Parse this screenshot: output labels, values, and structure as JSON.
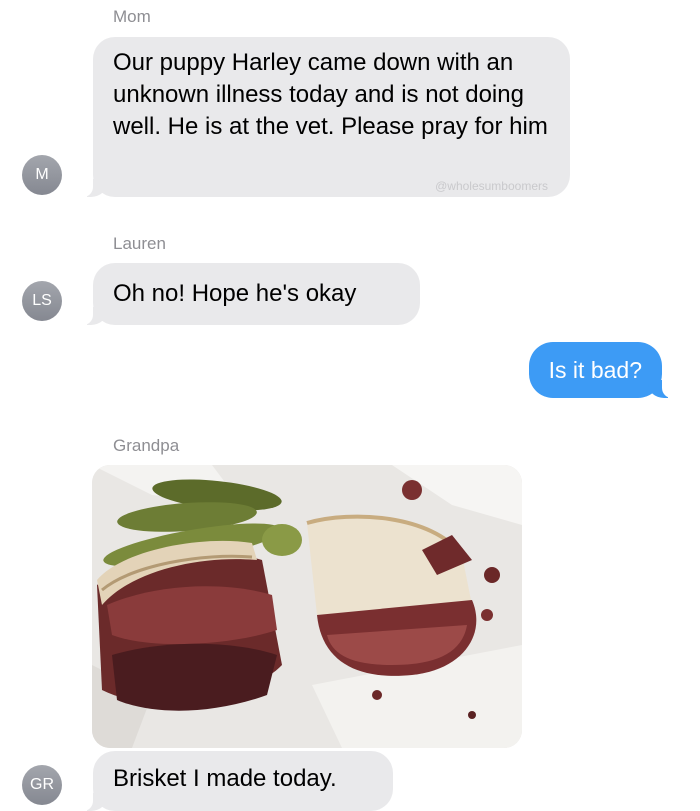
{
  "messages": {
    "mom": {
      "sender": "Mom",
      "avatar": "M",
      "text": "Our puppy Harley came down with an unknown illness today and is not doing well. He is at the vet. Please pray for him",
      "watermark": "@wholesumboomers"
    },
    "lauren": {
      "sender": "Lauren",
      "avatar": "LS",
      "text": "Oh no! Hope he's okay"
    },
    "me": {
      "text": "Is it bad?"
    },
    "grandpa": {
      "sender": "Grandpa",
      "avatar": "GR",
      "photo": "sandwich-photo",
      "text": "Brisket I made today."
    }
  },
  "colors": {
    "incoming_bubble": "#e9e9eb",
    "outgoing_bubble": "#3d9bf5",
    "avatar_gray": "#8e9097",
    "sender_label": "#8e8e93"
  }
}
